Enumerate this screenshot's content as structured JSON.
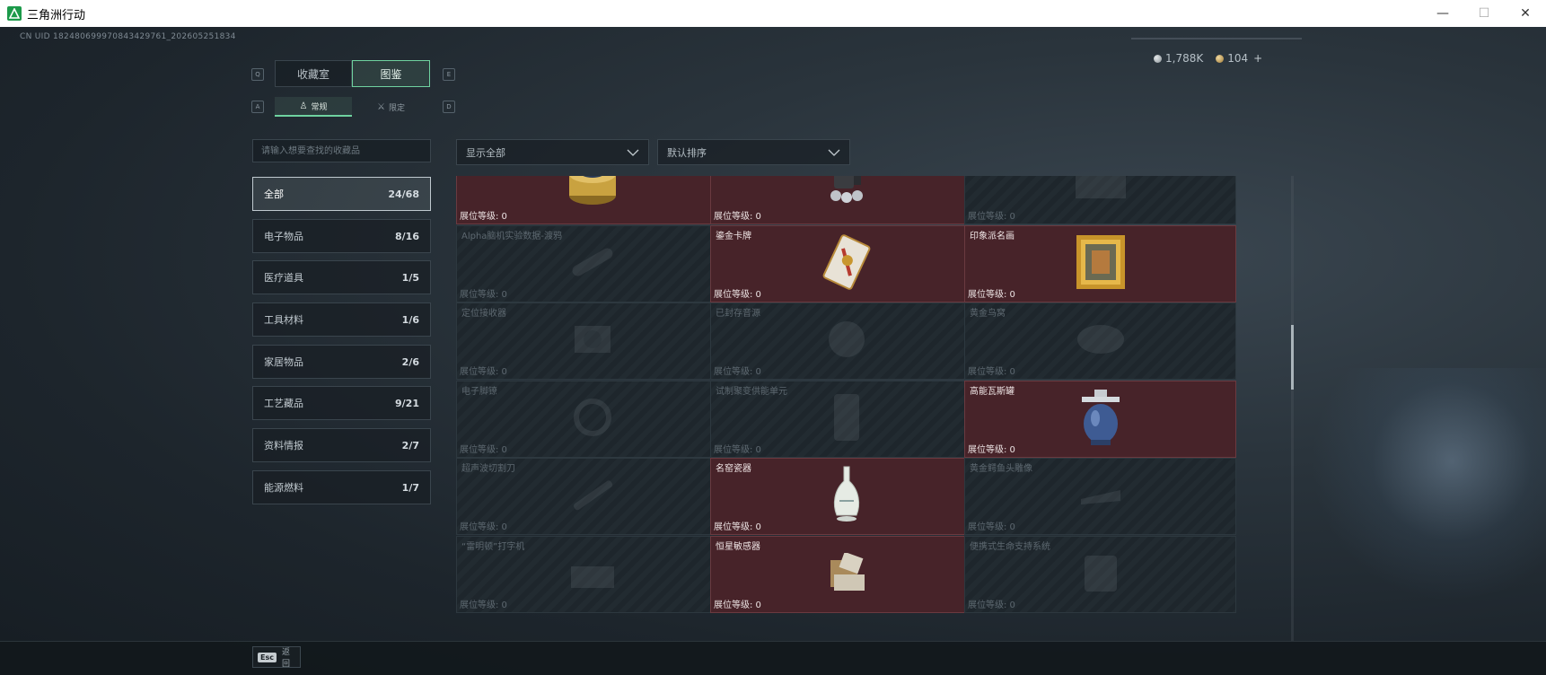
{
  "window": {
    "title": "三角洲行动",
    "minimize": "—",
    "maximize": "☐",
    "close": "✕"
  },
  "uid": "CN UID 182480699970843429761_202605251834",
  "currency": {
    "silver": "1,788K",
    "gold": "104",
    "plus": "+"
  },
  "keys": {
    "prev_tab": "Q",
    "next_tab": "E",
    "prev_sub": "A",
    "next_sub": "D"
  },
  "tabs": [
    {
      "label": "收藏室"
    },
    {
      "label": "图鉴"
    }
  ],
  "subtabs": [
    {
      "label": "常规",
      "icon": "person-icon"
    },
    {
      "label": "限定",
      "icon": "crossed-swords-icon"
    }
  ],
  "search": {
    "placeholder": "请输入想要查找的收藏品"
  },
  "filters": {
    "display": "显示全部",
    "sort": "默认排序"
  },
  "categories": [
    {
      "label": "全部",
      "count": "24/68"
    },
    {
      "label": "电子物品",
      "count": "8/16"
    },
    {
      "label": "医疗道具",
      "count": "1/5"
    },
    {
      "label": "工具材料",
      "count": "1/6"
    },
    {
      "label": "家居物品",
      "count": "2/6"
    },
    {
      "label": "工艺藏品",
      "count": "9/21"
    },
    {
      "label": "资料情报",
      "count": "2/7"
    },
    {
      "label": "能源燃料",
      "count": "1/7"
    }
  ],
  "level_label": "展位等级: 0",
  "items": [
    {
      "name": "",
      "owned": true,
      "icon": "caviar-tin-icon"
    },
    {
      "name": "",
      "owned": true,
      "icon": "robot-device-icon"
    },
    {
      "name": "",
      "owned": false,
      "icon": "box-icon"
    },
    {
      "name": "Alpha脑机实验数据-渡鸦",
      "owned": false,
      "icon": "tube-icon"
    },
    {
      "name": "鎏金卡牌",
      "owned": true,
      "icon": "gilded-card-icon"
    },
    {
      "name": "印象派名画",
      "owned": true,
      "icon": "framed-painting-icon"
    },
    {
      "name": "定位接收器",
      "owned": false,
      "icon": "receiver-icon"
    },
    {
      "name": "已封存音源",
      "owned": false,
      "icon": "disc-icon"
    },
    {
      "name": "黄金鸟窝",
      "owned": false,
      "icon": "nest-icon"
    },
    {
      "name": "电子脚镣",
      "owned": false,
      "icon": "anklet-icon"
    },
    {
      "name": "试制聚变供能单元",
      "owned": false,
      "icon": "power-cell-icon"
    },
    {
      "name": "高能瓦斯罐",
      "owned": true,
      "icon": "gas-canister-icon"
    },
    {
      "name": "超声波切割刀",
      "owned": false,
      "icon": "knife-icon"
    },
    {
      "name": "名窑瓷器",
      "owned": true,
      "icon": "porcelain-vase-icon"
    },
    {
      "name": "黄金鳄鱼头雕像",
      "owned": false,
      "icon": "croc-statue-icon"
    },
    {
      "name": "“雷明顿”打字机",
      "owned": false,
      "icon": "typewriter-icon"
    },
    {
      "name": "恒星敏感器",
      "owned": true,
      "icon": "star-sensor-icon"
    },
    {
      "name": "便携式生命支持系统",
      "owned": false,
      "icon": "life-support-icon"
    }
  ],
  "footer": {
    "esc_key": "Esc",
    "back_label": "返回"
  }
}
